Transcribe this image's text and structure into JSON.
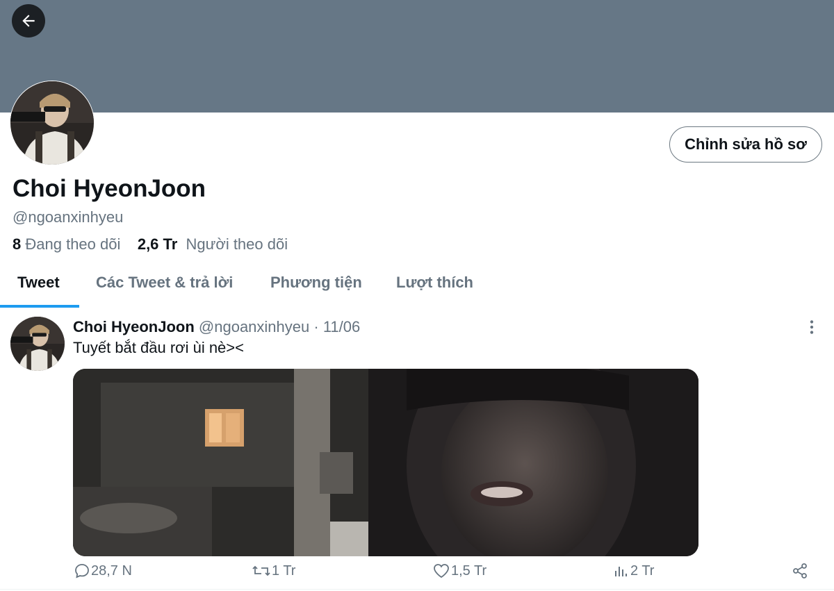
{
  "colors": {
    "banner": "#667786",
    "accent": "#1d9bf0",
    "muted": "#66737f",
    "text": "#0f1419"
  },
  "header": {
    "back_icon": "arrow-left-icon"
  },
  "profile": {
    "edit_button_label": "Chỉnh sửa hồ sơ",
    "display_name": "Choi HyeonJoon",
    "handle": "@ngoanxinhyeu",
    "following_count": "8",
    "following_label": "Đang theo dõi",
    "followers_count": "2,6 Tr",
    "followers_label": "Người theo dõi"
  },
  "tabs": [
    {
      "label": "Tweet",
      "active": true
    },
    {
      "label": "Các Tweet & trả lời",
      "active": false
    },
    {
      "label": "Phương tiện",
      "active": false
    },
    {
      "label": "Lượt thích",
      "active": false
    }
  ],
  "tweet": {
    "author_name": "Choi HyeonJoon",
    "author_handle": "@ngoanxinhyeu",
    "separator": "·",
    "date": "11/06",
    "text": "Tuyết bắt đầu rơi ùi nè><",
    "media_description_icon": "video-thumbnail",
    "actions": {
      "replies": "28,7 N",
      "retweets": "1 Tr",
      "likes": "1,5 Tr",
      "views": "2 Tr"
    }
  }
}
